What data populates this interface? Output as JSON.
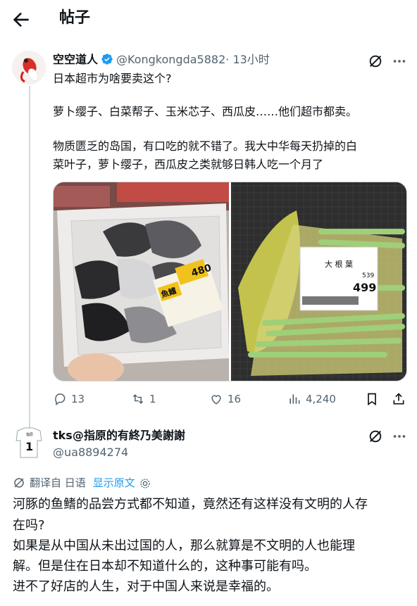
{
  "header": {
    "title": "帖子"
  },
  "post": {
    "display_name": "空空道人",
    "handle": "@Kongkongda5882",
    "time": "· 13小时",
    "lines": [
      "日本超市为啥要卖这个?",
      "萝卜缨子、白菜帮子、玉米芯子、西瓜皮……他们超市都卖。",
      "物质匮乏的岛国，有口吃的就不错了。我大中华每天扔掉的白",
      "菜叶子，萝卜缨子，西瓜皮之类就够日韩人吃一个月了"
    ],
    "media": {
      "left_label": {
        "price": "480",
        "tag": "魚鰭"
      },
      "right_label": {
        "name": "大 根 葉",
        "price": "499",
        "price_small": "539"
      }
    },
    "stats": {
      "replies": "13",
      "reposts": "1",
      "likes": "16",
      "views": "4,240"
    }
  },
  "reply": {
    "display_name": "tks@指原的有終乃美謝謝",
    "handle": "@ua8894274",
    "avatar_number": "1",
    "avatar_top_text": "指原",
    "translate_label": "翻译自 日语",
    "show_original": "显示原文",
    "lines": [
      "河豚的鱼鳍的品尝方式都不知道，竟然还有这样没有文明的人存",
      "在吗?",
      "如果是从中国从未出过国的人，那么就算是不文明的人也能理",
      "解。但是住在日本却不知道什么的，这种事可能有吗。",
      "进不了好店的人生，对于中国人来说是幸福的。"
    ]
  },
  "colors": {
    "accent": "#1d9bf0",
    "muted": "#536471",
    "verified": "#1d9bf0"
  },
  "icons": [
    "back-arrow-icon",
    "verified-badge-icon",
    "grok-icon",
    "more-icon",
    "reply-icon",
    "repost-icon",
    "like-icon",
    "views-icon",
    "bookmark-icon",
    "share-icon",
    "translate-icon",
    "settings-icon"
  ]
}
